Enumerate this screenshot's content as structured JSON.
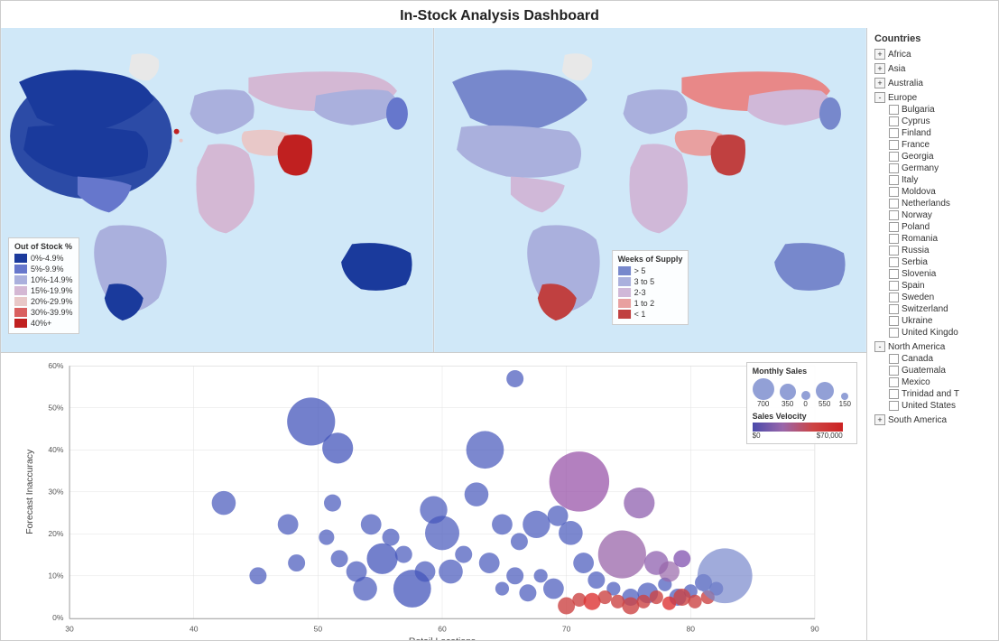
{
  "title": "In-Stock Analysis Dashboard",
  "sidebar": {
    "title": "Countries",
    "groups": [
      {
        "label": "Africa",
        "expanded": false,
        "children": []
      },
      {
        "label": "Asia",
        "expanded": false,
        "children": []
      },
      {
        "label": "Australia",
        "expanded": false,
        "children": []
      },
      {
        "label": "Europe",
        "expanded": true,
        "children": [
          "Bulgaria",
          "Cyprus",
          "Finland",
          "France",
          "Georgia",
          "Germany",
          "Italy",
          "Moldova",
          "Netherlands",
          "Norway",
          "Poland",
          "Romania",
          "Russia",
          "Serbia",
          "Slovenia",
          "Spain",
          "Sweden",
          "Switzerland",
          "Ukraine",
          "United Kingdo"
        ]
      },
      {
        "label": "North America",
        "expanded": true,
        "children": [
          "Canada",
          "Guatemala",
          "Mexico",
          "Trinidad and T",
          "United States"
        ]
      },
      {
        "label": "South America",
        "expanded": false,
        "children": []
      }
    ]
  },
  "left_legend": {
    "title": "Out of Stock %",
    "items": [
      {
        "color": "#1a3a9c",
        "label": "0%-4.9%"
      },
      {
        "color": "#6677cc",
        "label": "5%-9.9%"
      },
      {
        "color": "#aab0dd",
        "label": "10%-14.9%"
      },
      {
        "color": "#d4b8d4",
        "label": "15%-19.9%"
      },
      {
        "color": "#e8c8c8",
        "label": "20%-29.9%"
      },
      {
        "color": "#d96060",
        "label": "30%-39.9%"
      },
      {
        "color": "#c02020",
        "label": "40%+"
      }
    ]
  },
  "right_legend": {
    "title": "Weeks of Supply",
    "items": [
      {
        "color": "#7788cc",
        "label": "> 5"
      },
      {
        "color": "#aab0dd",
        "label": "3 to 5"
      },
      {
        "color": "#d0b8d8",
        "label": "2-3"
      },
      {
        "color": "#e8a0a0",
        "label": "1 to 2"
      },
      {
        "color": "#c04040",
        "label": "< 1"
      }
    ]
  },
  "scatter": {
    "x_label": "Retail Locations",
    "y_label": "Forecast Inaccuracy",
    "x_min": 30,
    "x_max": 90,
    "y_min": 0,
    "y_max": 60,
    "y_ticks": [
      "60%",
      "50%",
      "40%",
      "30%",
      "20%",
      "10%",
      "0%"
    ],
    "x_ticks": [
      "30",
      "40",
      "50",
      "60",
      "70",
      "80",
      "90"
    ]
  },
  "sales_legend": {
    "title": "Monthly Sales",
    "circles": [
      {
        "size": 28,
        "label": "700"
      },
      {
        "size": 20,
        "label": "350"
      },
      {
        "size": 14,
        "label": "0"
      },
      {
        "size": 22,
        "label": "550"
      },
      {
        "size": 10,
        "label": "150"
      }
    ],
    "velocity_title": "Sales Velocity",
    "velocity_min": "$0",
    "velocity_max": "$70,000"
  }
}
